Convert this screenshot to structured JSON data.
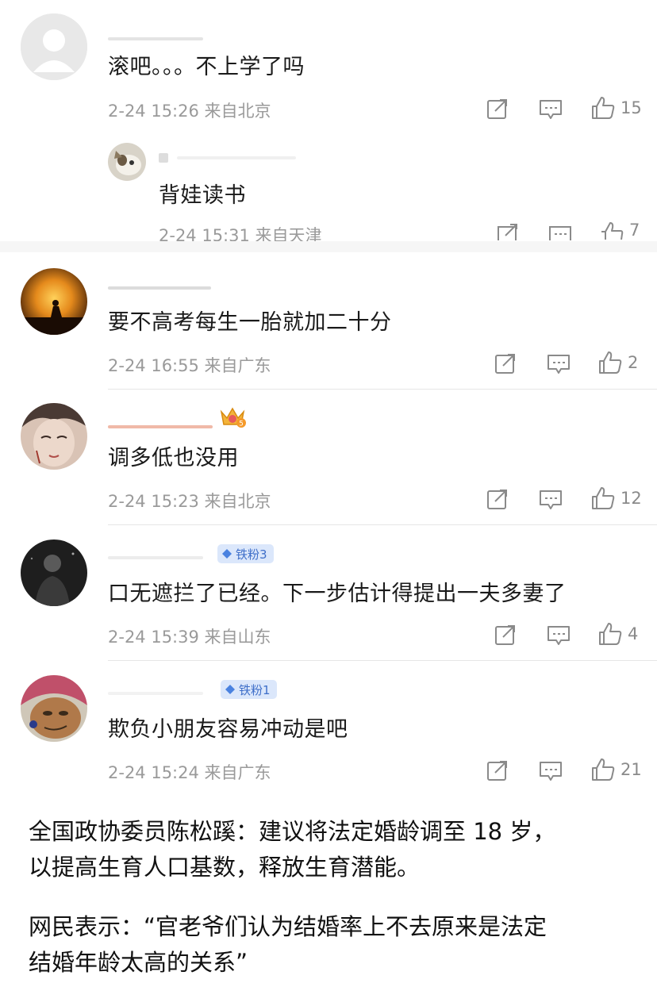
{
  "comments": [
    {
      "text": "滚吧。。。不上学了吗",
      "time": "2-24 15:26",
      "location": "来自北京",
      "likes": "15",
      "reply": {
        "text": "背娃读书",
        "time": "2-24 15:31",
        "location": "来自天津",
        "likes": "7"
      }
    },
    {
      "text": "要不高考每生一胎就加二十分",
      "time": "2-24 16:55",
      "location": "来自广东",
      "likes": "2"
    },
    {
      "text": "调多低也没用",
      "time": "2-24 15:23",
      "location": "来自北京",
      "likes": "12",
      "crown_level": "5"
    },
    {
      "text": "口无遮拦了已经。下一步估计得提出一夫多妻了",
      "time": "2-24 15:39",
      "location": "来自山东",
      "likes": "4",
      "badge": "铁粉3"
    },
    {
      "text": "欺负小朋友容易冲动是吧",
      "time": "2-24 15:24",
      "location": "来自广东",
      "likes": "21",
      "badge": "铁粉1"
    }
  ],
  "icons": {
    "share": "share-icon",
    "comment": "comment-icon",
    "like": "thumbs-up-icon",
    "badge": "diamond-icon",
    "crown": "crown-icon"
  },
  "colors": {
    "meta_text": "#9a9a9a",
    "badge_bg": "#dbe7fb",
    "badge_text": "#3f6fc9",
    "divider": "#e6e6e6"
  },
  "caption": {
    "line1": "全国政协委员陈松蹊：建议将法定婚龄调至 18 岁，",
    "line2": "以提高生育人口基数，释放生育潜能。",
    "line3": "网民表示：“官老爷们认为结婚率上不去原来是法定",
    "line4": "结婚年龄太高的关系”"
  }
}
